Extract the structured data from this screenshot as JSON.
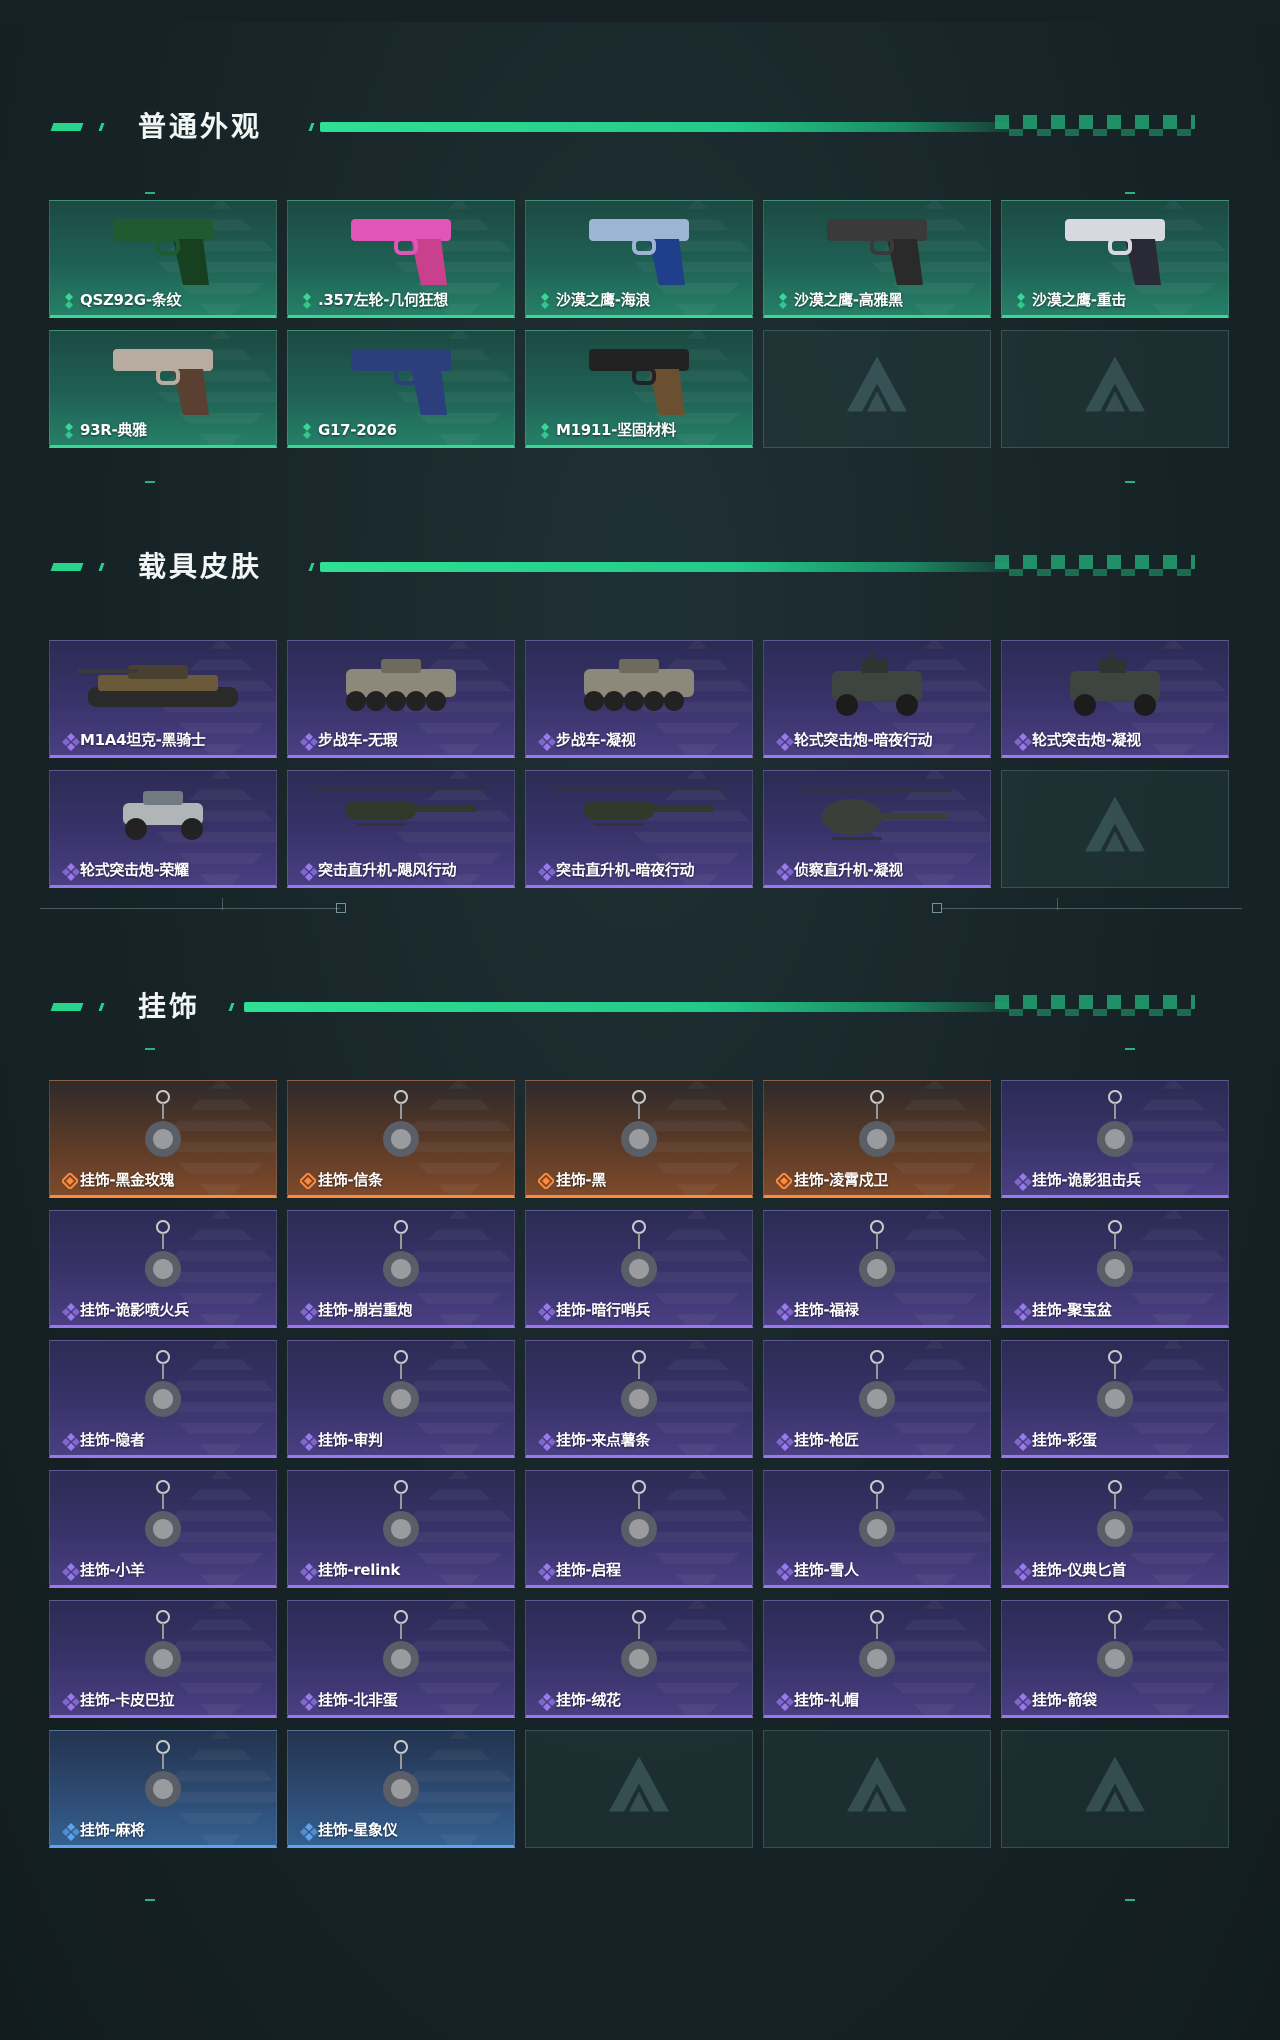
{
  "sections": [
    {
      "title": "普通外观",
      "items": [
        {
          "label": "QSZ92G-条纹",
          "rarity": "green",
          "icon": "pistol-camo-icon"
        },
        {
          "label": ".357左轮-几何狂想",
          "rarity": "green",
          "icon": "revolver-pink-icon"
        },
        {
          "label": "沙漠之鹰-海浪",
          "rarity": "green",
          "icon": "desert-eagle-wave-icon"
        },
        {
          "label": "沙漠之鹰-高雅黑",
          "rarity": "green",
          "icon": "desert-eagle-black-icon"
        },
        {
          "label": "沙漠之鹰-重击",
          "rarity": "green",
          "icon": "desert-eagle-strike-icon"
        },
        {
          "label": "93R-典雅",
          "rarity": "green",
          "icon": "pistol-93r-icon"
        },
        {
          "label": "G17-2026",
          "rarity": "green",
          "icon": "pistol-g17-icon"
        },
        {
          "label": "M1911-坚固材料",
          "rarity": "green",
          "icon": "pistol-m1911-icon"
        },
        {
          "label": "",
          "rarity": "empty",
          "icon": "empty-slot-logo-icon"
        },
        {
          "label": "",
          "rarity": "empty",
          "icon": "empty-slot-logo-icon"
        }
      ]
    },
    {
      "title": "载具皮肤",
      "items": [
        {
          "label": "M1A4坦克-黑骑士",
          "rarity": "purple",
          "icon": "tank-icon"
        },
        {
          "label": "步战车-无瑕",
          "rarity": "purple",
          "icon": "ifv-icon"
        },
        {
          "label": "步战车-凝视",
          "rarity": "purple",
          "icon": "ifv-icon"
        },
        {
          "label": "轮式突击炮-暗夜行动",
          "rarity": "purple",
          "icon": "armored-car-icon"
        },
        {
          "label": "轮式突击炮-凝视",
          "rarity": "purple",
          "icon": "armored-car-icon"
        },
        {
          "label": "轮式突击炮-荣耀",
          "rarity": "purple",
          "icon": "buggy-icon"
        },
        {
          "label": "突击直升机-飓风行动",
          "rarity": "purple",
          "icon": "attack-helicopter-icon"
        },
        {
          "label": "突击直升机-暗夜行动",
          "rarity": "purple",
          "icon": "attack-helicopter-icon"
        },
        {
          "label": "侦察直升机-凝视",
          "rarity": "purple",
          "icon": "scout-helicopter-icon"
        },
        {
          "label": "",
          "rarity": "empty",
          "icon": "empty-slot-logo-icon"
        }
      ]
    },
    {
      "title": "挂饰",
      "items": [
        {
          "label": "挂饰-黑金玫瑰",
          "rarity": "orange",
          "icon": "charm-icon"
        },
        {
          "label": "挂饰-信条",
          "rarity": "orange",
          "icon": "charm-icon"
        },
        {
          "label": "挂饰-黑",
          "rarity": "orange",
          "icon": "charm-icon"
        },
        {
          "label": "挂饰-凌霄戍卫",
          "rarity": "orange",
          "icon": "charm-icon"
        },
        {
          "label": "挂饰-诡影狙击兵",
          "rarity": "purple",
          "icon": "charm-icon"
        },
        {
          "label": "挂饰-诡影喷火兵",
          "rarity": "purple",
          "icon": "charm-icon"
        },
        {
          "label": "挂饰-崩岩重炮",
          "rarity": "purple",
          "icon": "charm-icon"
        },
        {
          "label": "挂饰-暗行哨兵",
          "rarity": "purple",
          "icon": "charm-icon"
        },
        {
          "label": "挂饰-福禄",
          "rarity": "purple",
          "icon": "charm-icon"
        },
        {
          "label": "挂饰-聚宝盆",
          "rarity": "purple",
          "icon": "charm-icon"
        },
        {
          "label": "挂饰-隐者",
          "rarity": "purple",
          "icon": "charm-icon"
        },
        {
          "label": "挂饰-审判",
          "rarity": "purple",
          "icon": "charm-icon"
        },
        {
          "label": "挂饰-来点薯条",
          "rarity": "purple",
          "icon": "charm-icon"
        },
        {
          "label": "挂饰-枪匠",
          "rarity": "purple",
          "icon": "charm-icon"
        },
        {
          "label": "挂饰-彩蛋",
          "rarity": "purple",
          "icon": "charm-icon"
        },
        {
          "label": "挂饰-小羊",
          "rarity": "purple",
          "icon": "charm-icon"
        },
        {
          "label": "挂饰-relink",
          "rarity": "purple",
          "icon": "charm-icon"
        },
        {
          "label": "挂饰-启程",
          "rarity": "purple",
          "icon": "charm-icon"
        },
        {
          "label": "挂饰-雪人",
          "rarity": "purple",
          "icon": "charm-icon"
        },
        {
          "label": "挂饰-仪典匕首",
          "rarity": "purple",
          "icon": "charm-icon"
        },
        {
          "label": "挂饰-卡皮巴拉",
          "rarity": "purple",
          "icon": "charm-icon"
        },
        {
          "label": "挂饰-北非蛋",
          "rarity": "purple",
          "icon": "charm-icon"
        },
        {
          "label": "挂饰-绒花",
          "rarity": "purple",
          "icon": "charm-icon"
        },
        {
          "label": "挂饰-礼帽",
          "rarity": "purple",
          "icon": "charm-icon"
        },
        {
          "label": "挂饰-箭袋",
          "rarity": "purple",
          "icon": "charm-icon"
        },
        {
          "label": "挂饰-麻将",
          "rarity": "blue",
          "icon": "charm-icon"
        },
        {
          "label": "挂饰-星象仪",
          "rarity": "blue",
          "icon": "charm-icon"
        },
        {
          "label": "",
          "rarity": "empty",
          "icon": "empty-slot-logo-icon"
        },
        {
          "label": "",
          "rarity": "empty",
          "icon": "empty-slot-logo-icon"
        },
        {
          "label": "",
          "rarity": "empty",
          "icon": "empty-slot-logo-icon"
        }
      ]
    }
  ],
  "colors": {
    "accent": "#27d58a",
    "green": "#38d994",
    "purple": "#9a79ef",
    "orange": "#ff8a3b",
    "blue": "#5ea2f0"
  }
}
